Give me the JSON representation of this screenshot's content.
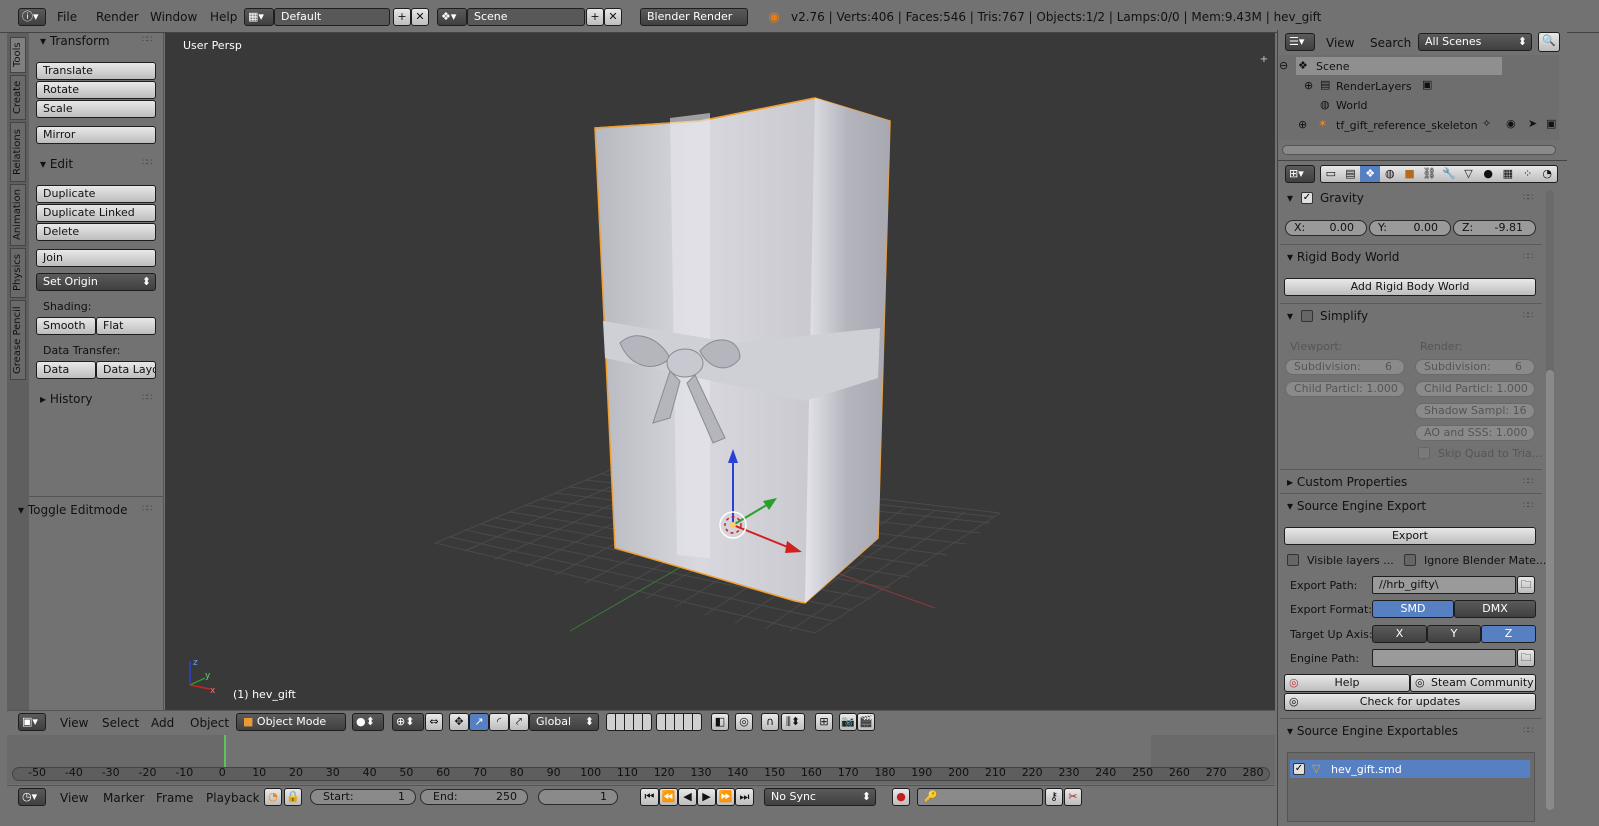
{
  "top_header": {
    "menus": [
      "File",
      "Render",
      "Window",
      "Help"
    ],
    "layout": "Default",
    "scene": "Scene",
    "engine": "Blender Render",
    "stats": "v2.76 | Verts:406 | Faces:546 | Tris:767 | Objects:1/2 | Lamps:0/0 | Mem:9.43M | hev_gift"
  },
  "tool_tabs": [
    "Tools",
    "Create",
    "Relations",
    "Animation",
    "Physics",
    "Grease Pencil"
  ],
  "tool_shelf": {
    "transform_title": "Transform",
    "translate": "Translate",
    "rotate": "Rotate",
    "scale": "Scale",
    "mirror": "Mirror",
    "edit_title": "Edit",
    "duplicate": "Duplicate",
    "duplicate_linked": "Duplicate Linked",
    "delete": "Delete",
    "join": "Join",
    "set_origin": "Set Origin",
    "shading_label": "Shading:",
    "smooth": "Smooth",
    "flat": "Flat",
    "data_transfer_label": "Data Transfer:",
    "data": "Data",
    "data_layout": "Data Layo",
    "history_title": "History",
    "toggle_editmode": "Toggle Editmode"
  },
  "viewport": {
    "view_label": "User Persp",
    "object_label": "(1) hev_gift"
  },
  "view3d_header": {
    "menus": [
      "View",
      "Select",
      "Add",
      "Object"
    ],
    "mode": "Object Mode",
    "orientation": "Global"
  },
  "timeline": {
    "ticks": [
      "-50",
      "-40",
      "-30",
      "-20",
      "-10",
      "0",
      "10",
      "20",
      "30",
      "40",
      "50",
      "60",
      "70",
      "80",
      "90",
      "100",
      "110",
      "120",
      "130",
      "140",
      "150",
      "160",
      "170",
      "180",
      "190",
      "200",
      "210",
      "220",
      "230",
      "240",
      "250",
      "260",
      "270",
      "280"
    ],
    "menus": [
      "View",
      "Marker",
      "Frame",
      "Playback"
    ],
    "start_label": "Start:",
    "start": "1",
    "end_label": "End:",
    "end": "250",
    "current": "1",
    "sync": "No Sync"
  },
  "outliner": {
    "menus": [
      "View",
      "Search"
    ],
    "filter": "All Scenes",
    "items": [
      {
        "label": "Scene",
        "indent": 0
      },
      {
        "label": "RenderLayers",
        "indent": 1
      },
      {
        "label": "World",
        "indent": 1
      },
      {
        "label": "tf_gift_reference_skeleton",
        "indent": 1
      }
    ]
  },
  "properties": {
    "gravity": {
      "title": "Gravity",
      "x": "X:",
      "xv": "0.00",
      "y": "Y:",
      "yv": "0.00",
      "z": "Z:",
      "zv": "-9.81"
    },
    "rigid_body_world": {
      "title": "Rigid Body World",
      "button": "Add Rigid Body World"
    },
    "simplify": {
      "title": "Simplify",
      "viewport_label": "Viewport:",
      "render_label": "Render:",
      "vp_subdivision": "Subdivision:",
      "vp_subdivision_val": "6",
      "vp_child": "Child Particl: 1.000",
      "r_subdivision": "Subdivision:",
      "r_subdivision_val": "6",
      "r_child": "Child Particl: 1.000",
      "r_shadow": "Shadow Sampl: 16",
      "r_ao": "AO and SSS: 1.000",
      "r_skip": "Skip Quad to Tria..."
    },
    "custom_properties": "Custom Properties",
    "source_export": {
      "title": "Source Engine Export",
      "export_button": "Export",
      "visible_layers": "Visible layers ...",
      "ignore_materials": "Ignore Blender Mate...",
      "export_path_label": "Export Path:",
      "export_path": "//hrb_gifty\\",
      "export_format_label": "Export Format:",
      "smd": "SMD",
      "dmx": "DMX",
      "up_axis_label": "Target Up Axis:",
      "axis_x": "X",
      "axis_y": "Y",
      "axis_z": "Z",
      "engine_path_label": "Engine Path:",
      "help": "Help",
      "steam": "Steam Community",
      "check_updates": "Check for updates"
    },
    "exportables": {
      "title": "Source Engine Exportables",
      "item": "hev_gift.smd"
    }
  },
  "colors": {
    "viewport_bg": "#393939",
    "selection_outline": "#f0a030",
    "active_blue": "#5680c2",
    "panel_bg": "#727272"
  }
}
